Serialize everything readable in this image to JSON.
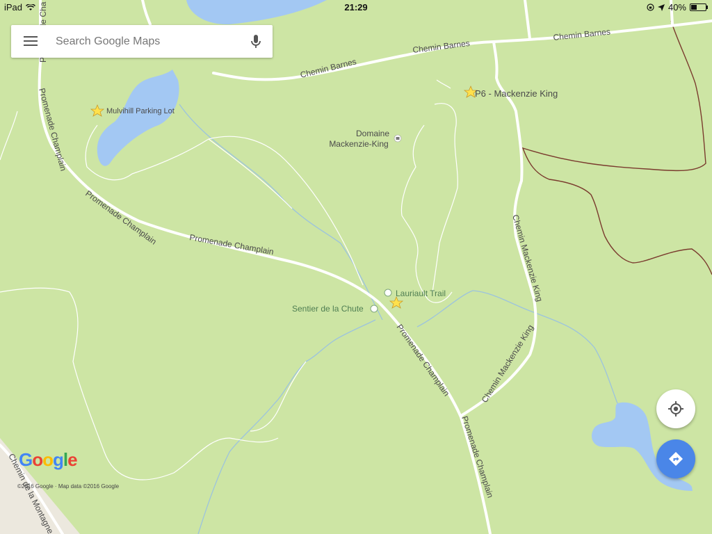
{
  "status_bar": {
    "device": "iPad",
    "time": "21:29",
    "battery": "40%",
    "battery_level": 0.4
  },
  "search": {
    "placeholder": "Search Google Maps"
  },
  "icons": {
    "menu": "hamburger-menu-icon",
    "mic": "microphone-icon",
    "locate": "my-location-icon",
    "directions": "directions-icon"
  },
  "colors": {
    "park": "#cde5a4",
    "water": "#a3c8f3",
    "road": "#ffffff",
    "trail": "#9cc3de",
    "boundary": "#7a3b2e",
    "star": "#ffe14d",
    "directions_button": "#4a86e8"
  },
  "map": {
    "road_labels": [
      "Promenade Cha",
      "Promenade Champlain",
      "Promenade Champlain",
      "Promenade Champlain",
      "Promenade Champlain",
      "Promenade Champlain",
      "Chemin Barnes",
      "Chemin Barnes",
      "Chemin Barnes",
      "Chemin Mackenzie King",
      "Chemin Mackenzie King",
      "Chemin de la Montagne"
    ],
    "places": [
      {
        "name": "Mulvihill Parking Lot",
        "marker": "star"
      },
      {
        "name": "P6 - Mackenzie King",
        "marker": "star"
      },
      {
        "name": "Lauriault Trail",
        "marker": "star"
      },
      {
        "name": "Sentier de la Chute",
        "marker": "hiking"
      }
    ],
    "landmark": {
      "line1": "Domaine",
      "line2": "Mackenzie-King",
      "icon": "castle-icon"
    }
  },
  "footer": {
    "logo": "Google",
    "copyright": "©2016 Google · Map data ©2016 Google"
  }
}
